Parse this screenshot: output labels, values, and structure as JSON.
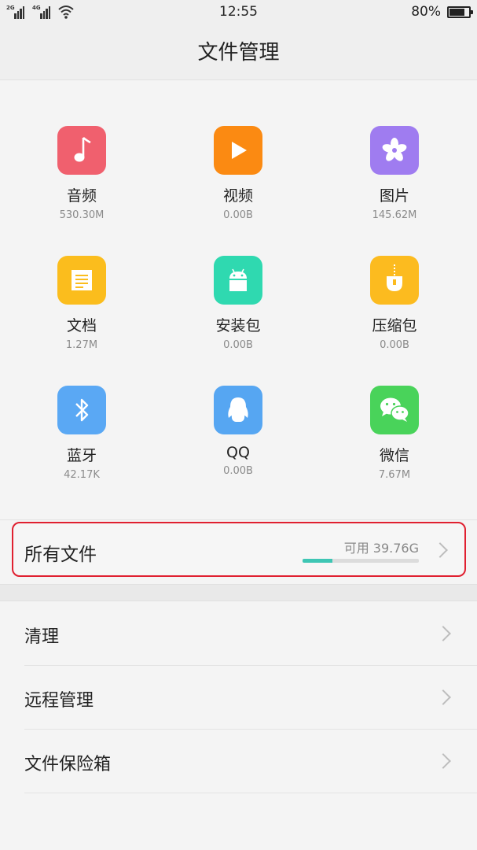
{
  "status_bar": {
    "sim1": "2G",
    "sim2": "4G",
    "time": "12:55",
    "battery_text": "80%",
    "battery_level": 0.8
  },
  "header": {
    "title": "文件管理"
  },
  "categories": [
    {
      "label": "音频",
      "size": "530.30M",
      "color": "#f0606e",
      "icon": "music-note-icon"
    },
    {
      "label": "视频",
      "size": "0.00B",
      "color": "#fb8a12",
      "icon": "play-icon"
    },
    {
      "label": "图片",
      "size": "145.62M",
      "color": "#9f7cf0",
      "icon": "flower-icon"
    },
    {
      "label": "文档",
      "size": "1.27M",
      "color": "#fbbd1d",
      "icon": "document-icon"
    },
    {
      "label": "安装包",
      "size": "0.00B",
      "color": "#2fd9b0",
      "icon": "android-icon"
    },
    {
      "label": "压缩包",
      "size": "0.00B",
      "color": "#fcbb1f",
      "icon": "zip-icon"
    },
    {
      "label": "蓝牙",
      "size": "42.17K",
      "color": "#5aa8f4",
      "icon": "bluetooth-icon"
    },
    {
      "label": "QQ",
      "size": "0.00B",
      "color": "#56a6f2",
      "icon": "qq-penguin-icon"
    },
    {
      "label": "微信",
      "size": "7.67M",
      "color": "#49d35a",
      "icon": "wechat-icon"
    }
  ],
  "all_files": {
    "label": "所有文件",
    "available": "可用 39.76G",
    "used_fraction": 0.26,
    "bar_color": "#3ec6b4"
  },
  "menu": [
    {
      "label": "清理"
    },
    {
      "label": "远程管理"
    },
    {
      "label": "文件保险箱"
    }
  ]
}
